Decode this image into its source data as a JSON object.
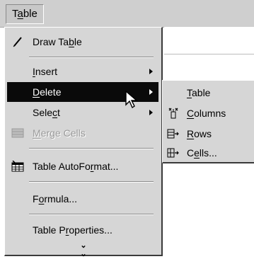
{
  "menubar": {
    "title": "Table"
  },
  "menu": {
    "items": [
      {
        "label": "Draw Table",
        "icon": "pencil-icon"
      },
      {
        "label": "Insert",
        "icon": ""
      },
      {
        "label": "Delete",
        "icon": ""
      },
      {
        "label": "Select",
        "icon": ""
      },
      {
        "label": "Merge Cells",
        "icon": "merge-cells-icon"
      },
      {
        "label": "Table AutoFormat...",
        "icon": "table-autoformat-icon"
      },
      {
        "label": "Formula...",
        "icon": ""
      },
      {
        "label": "Table Properties...",
        "icon": ""
      }
    ],
    "expand_icon": "double-chevron-down-icon"
  },
  "submenu": {
    "items": [
      {
        "label": "Table",
        "icon": ""
      },
      {
        "label": "Columns",
        "icon": "delete-columns-icon"
      },
      {
        "label": "Rows",
        "icon": "delete-rows-icon"
      },
      {
        "label": "Cells...",
        "icon": "delete-cells-icon"
      }
    ]
  },
  "colors": {
    "menu_bg": "#d6d6d6",
    "highlight": "#0a0a0a",
    "disabled": "#9a9a9a"
  }
}
